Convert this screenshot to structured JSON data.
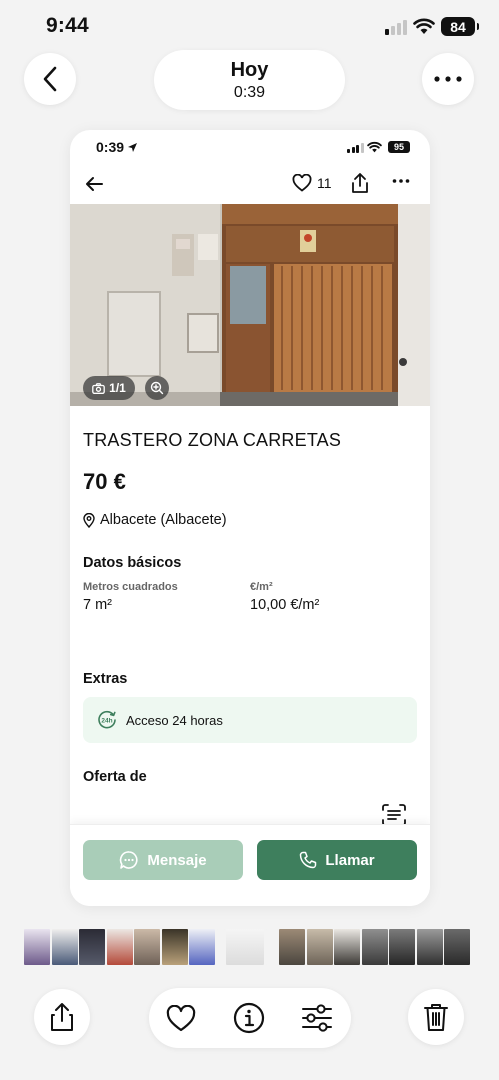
{
  "os_status": {
    "time": "9:44",
    "battery": "84"
  },
  "viewer": {
    "title": "Hoy",
    "subtitle": "0:39",
    "back_icon": "chevron-left-icon",
    "more_icon": "ellipsis-icon"
  },
  "screenshot": {
    "status": {
      "time": "0:39",
      "battery": "95"
    },
    "nav": {
      "likes": "11"
    },
    "photo": {
      "counter": "1/1"
    },
    "listing": {
      "title": "TRASTERO ZONA CARRETAS",
      "price": "70 €",
      "location": "Albacete (Albacete)"
    },
    "basic_data": {
      "heading": "Datos básicos",
      "fields": [
        {
          "label": "Metros cuadrados",
          "value": "7 m²"
        },
        {
          "label": "€/m²",
          "value": "10,00 €/m²"
        }
      ]
    },
    "extras": {
      "heading": "Extras",
      "items": [
        {
          "label": "Acceso 24 horas",
          "icon_text": "24h"
        }
      ]
    },
    "offer": {
      "heading": "Oferta de"
    },
    "actions": {
      "message": "Mensaje",
      "call": "Llamar"
    },
    "colors": {
      "accent": "#3e7f5d",
      "accent_light": "#a9cdb8",
      "extra_bg": "#eef8f1"
    }
  },
  "toolbar": {
    "icons": [
      "share-icon",
      "heart-icon",
      "info-icon",
      "adjust-icon",
      "trash-icon"
    ]
  }
}
